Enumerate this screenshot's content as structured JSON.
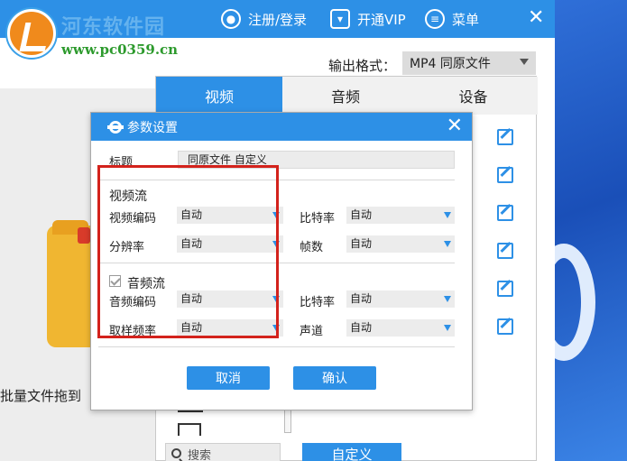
{
  "app": {
    "watermark_name": "河东软件园",
    "watermark_url": "www.pc0359.cn",
    "titlebar": {
      "register_login": "注册/登录",
      "vip": "开通VIP",
      "menu": "菜单",
      "close_glyph": "✕"
    },
    "drag_hint": "批量文件拖到",
    "output_format_label": "输出格式：",
    "output_format_value": "MP4 同原文件"
  },
  "panel": {
    "tabs": [
      "视频",
      "音频",
      "设备"
    ],
    "search_placeholder": "搜索",
    "custom_button": "自定义"
  },
  "dialog": {
    "title": "参数设置",
    "close_glyph": "✕",
    "label_title": "标题",
    "title_value": "同原文件 自定义",
    "video_stream": {
      "heading": "视频流",
      "codec_label": "视频编码",
      "codec_value": "自动",
      "bitrate_label": "比特率",
      "bitrate_value": "自动",
      "resolution_label": "分辨率",
      "resolution_value": "自动",
      "framerate_label": "帧数",
      "framerate_value": "自动"
    },
    "audio_stream": {
      "heading": "音频流",
      "enabled": true,
      "codec_label": "音频编码",
      "codec_value": "自动",
      "bitrate_label": "比特率",
      "bitrate_value": "自动",
      "samplerate_label": "取样频率",
      "samplerate_value": "自动",
      "channel_label": "声道",
      "channel_value": "自动"
    },
    "cancel": "取消",
    "confirm": "确认"
  },
  "colors": {
    "accent": "#2d90e6",
    "highlight": "#d3221c"
  }
}
